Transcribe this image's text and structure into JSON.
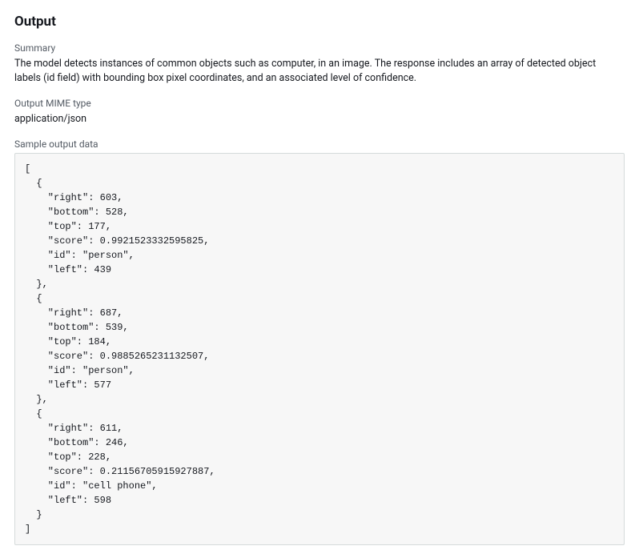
{
  "section": {
    "title": "Output"
  },
  "summary": {
    "label": "Summary",
    "value": "The model detects instances of common objects such as computer, in an image. The response includes an array of detected object labels (id field) with bounding box pixel coordinates, and an associated level of confidence."
  },
  "mime": {
    "label": "Output MIME type",
    "value": "application/json"
  },
  "sample": {
    "label": "Sample output data",
    "code": "[\n  {\n    \"right\": 603,\n    \"bottom\": 528,\n    \"top\": 177,\n    \"score\": 0.9921523332595825,\n    \"id\": \"person\",\n    \"left\": 439\n  },\n  {\n    \"right\": 687,\n    \"bottom\": 539,\n    \"top\": 184,\n    \"score\": 0.9885265231132507,\n    \"id\": \"person\",\n    \"left\": 577\n  },\n  {\n    \"right\": 611,\n    \"bottom\": 246,\n    \"top\": 228,\n    \"score\": 0.21156705915927887,\n    \"id\": \"cell phone\",\n    \"left\": 598\n  }\n]"
  }
}
